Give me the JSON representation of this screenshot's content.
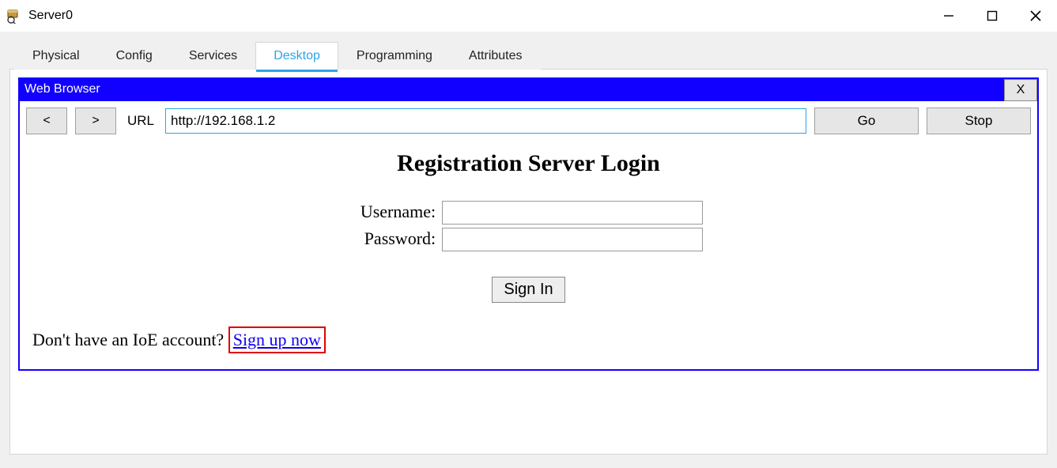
{
  "window": {
    "title": "Server0",
    "controls": {
      "min_name": "minimize-icon",
      "max_name": "maximize-icon",
      "close_name": "close-icon"
    }
  },
  "tabs": [
    {
      "label": "Physical",
      "active": false
    },
    {
      "label": "Config",
      "active": false
    },
    {
      "label": "Services",
      "active": false
    },
    {
      "label": "Desktop",
      "active": true
    },
    {
      "label": "Programming",
      "active": false
    },
    {
      "label": "Attributes",
      "active": false
    }
  ],
  "browser": {
    "title": "Web Browser",
    "close_label": "X",
    "nav_back": "<",
    "nav_fwd": ">",
    "url_label": "URL",
    "url_value": "http://192.168.1.2",
    "go_label": "Go",
    "stop_label": "Stop"
  },
  "page": {
    "heading": "Registration Server Login",
    "username_label": "Username:",
    "username_value": "",
    "password_label": "Password:",
    "password_value": "",
    "signin_label": "Sign In",
    "signup_prompt": "Don't have an IoE account? ",
    "signup_link": "Sign up now"
  }
}
